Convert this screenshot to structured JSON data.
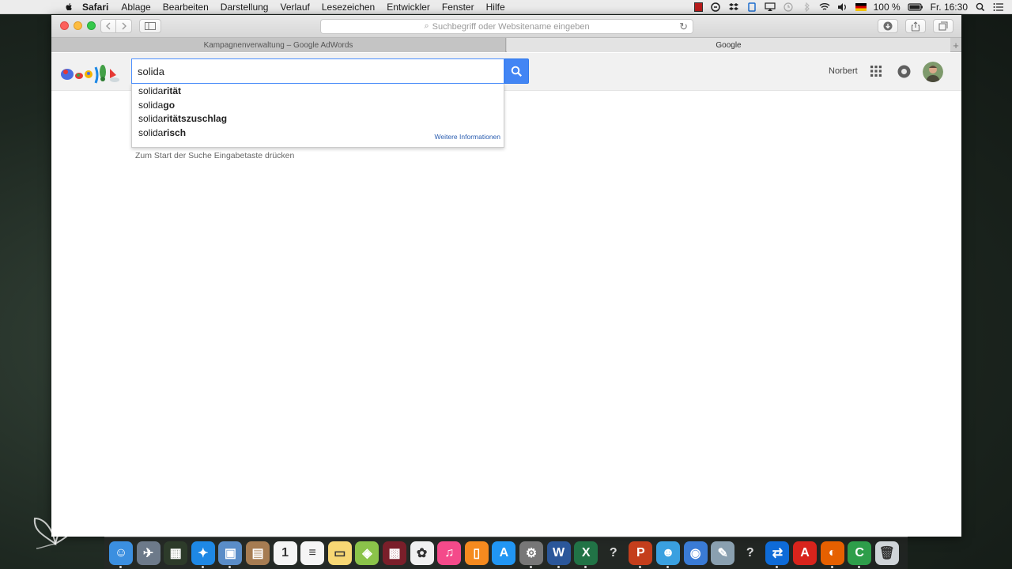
{
  "menubar": {
    "app_name": "Safari",
    "items": [
      "Ablage",
      "Bearbeiten",
      "Darstellung",
      "Verlauf",
      "Lesezeichen",
      "Entwickler",
      "Fenster",
      "Hilfe"
    ],
    "battery": "100 %",
    "clock": "Fr. 16:30"
  },
  "browser": {
    "address_placeholder": "Suchbegriff oder Websitename eingeben",
    "tabs": [
      {
        "label": "Kampagnenverwaltung – Google AdWords",
        "active": false
      },
      {
        "label": "Google",
        "active": true
      }
    ],
    "tab_add": "+"
  },
  "google": {
    "search_value": "solida",
    "user_name": "Norbert",
    "suggestions": [
      {
        "prefix": "solida",
        "completion": "rität"
      },
      {
        "prefix": "solida",
        "completion": "go"
      },
      {
        "prefix": "solida",
        "completion": "ritätszuschlag"
      },
      {
        "prefix": "solida",
        "completion": "risch"
      }
    ],
    "more_info": "Weitere Informationen",
    "hint": "Zum Start der Suche Eingabetaste drücken",
    "accent_color": "#4285f4"
  },
  "dock": {
    "apps": [
      {
        "name": "finder-icon",
        "color": "#3b8fe0",
        "glyph": "☺"
      },
      {
        "name": "launchpad-icon",
        "color": "#6d7a8a",
        "glyph": "✈"
      },
      {
        "name": "mission-control-icon",
        "color": "#2d3b2a",
        "glyph": "▦"
      },
      {
        "name": "safari-icon",
        "color": "#1e88e5",
        "glyph": "✦"
      },
      {
        "name": "preview-icon",
        "color": "#5a8dc8",
        "glyph": "▣"
      },
      {
        "name": "contacts-icon",
        "color": "#a67c52",
        "glyph": "▤"
      },
      {
        "name": "calendar-icon",
        "color": "#f5f5f5",
        "glyph": "1"
      },
      {
        "name": "reminders-icon",
        "color": "#f5f5f5",
        "glyph": "≡"
      },
      {
        "name": "notes-icon",
        "color": "#f7d774",
        "glyph": "▭"
      },
      {
        "name": "maps-icon",
        "color": "#8bc34a",
        "glyph": "◈"
      },
      {
        "name": "photo-booth-icon",
        "color": "#7a1f2a",
        "glyph": "▩"
      },
      {
        "name": "photos-icon",
        "color": "#f0f0f0",
        "glyph": "✿"
      },
      {
        "name": "itunes-icon",
        "color": "#f44a8a",
        "glyph": "♫"
      },
      {
        "name": "ibooks-icon",
        "color": "#f58a1f",
        "glyph": "▯"
      },
      {
        "name": "app-store-icon",
        "color": "#2196f3",
        "glyph": "A"
      },
      {
        "name": "system-preferences-icon",
        "color": "#777777",
        "glyph": "⚙"
      },
      {
        "name": "word-icon",
        "color": "#2b579a",
        "glyph": "W"
      },
      {
        "name": "excel-icon",
        "color": "#217346",
        "glyph": "X"
      },
      {
        "name": "unknown-app-icon",
        "color": "transparent",
        "glyph": "?"
      },
      {
        "name": "powerpoint-icon",
        "color": "#c43e1c",
        "glyph": "P"
      },
      {
        "name": "messenger-icon",
        "color": "#3aa0e0",
        "glyph": "☻"
      },
      {
        "name": "network-icon",
        "color": "#3a7bd5",
        "glyph": "◉"
      },
      {
        "name": "utility-icon",
        "color": "#8aa0b0",
        "glyph": "✎"
      },
      {
        "name": "unknown-app-2-icon",
        "color": "transparent",
        "glyph": "?"
      },
      {
        "name": "teamviewer-icon",
        "color": "#0e6bd8",
        "glyph": "⇄"
      },
      {
        "name": "acrobat-icon",
        "color": "#d8241c",
        "glyph": "A"
      },
      {
        "name": "firefox-icon",
        "color": "#e66000",
        "glyph": "◐"
      },
      {
        "name": "camtasia-icon",
        "color": "#2e9e4a",
        "glyph": "C"
      },
      {
        "name": "trash-icon",
        "color": "#cfd4d8",
        "glyph": "🗑"
      }
    ]
  }
}
